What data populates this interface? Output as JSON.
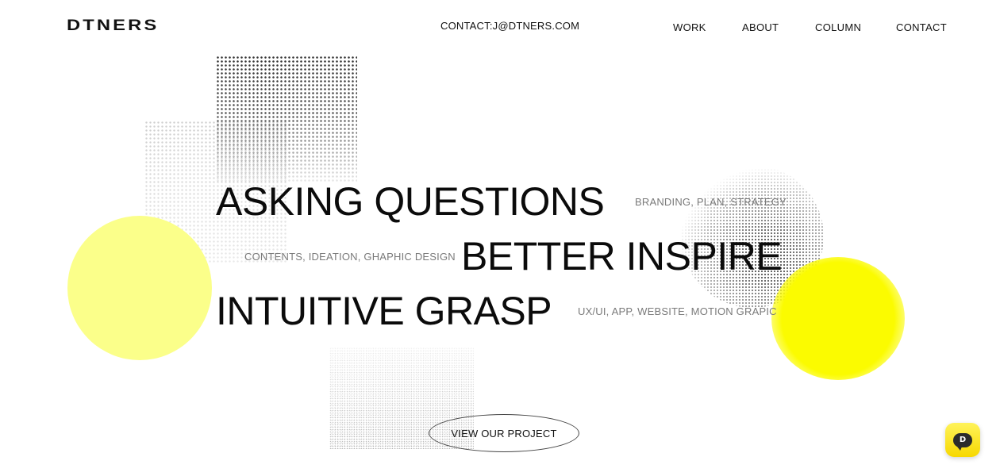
{
  "header": {
    "logo": "DTNERS",
    "contact": "CONTACT:J@DTNERS.COM",
    "nav": [
      "WORK",
      "ABOUT",
      "COLUMN",
      "CONTACT"
    ]
  },
  "hero": {
    "lines": [
      {
        "headline": "ASKING QUESTIONS",
        "tag": "BRANDING, PLAN, STRATEGY"
      },
      {
        "headline": "BETTER INSPIRE",
        "tag": "CONTENTS, IDEATION, GHAPHIC DESIGN"
      },
      {
        "headline": "INTUITIVE GRASP",
        "tag": "UX/UI, APP, WEBSITE, MOTION GRAPIC"
      }
    ],
    "cta": "VIEW OUR PROJECT"
  },
  "chat_widget": {
    "letter": "D",
    "icon": "chat-bubble-icon"
  },
  "colors": {
    "accent_yellow": "#fbfb00",
    "pale_yellow": "#fbff8a",
    "text": "#111111",
    "tag_gray": "#7a7a7a"
  }
}
